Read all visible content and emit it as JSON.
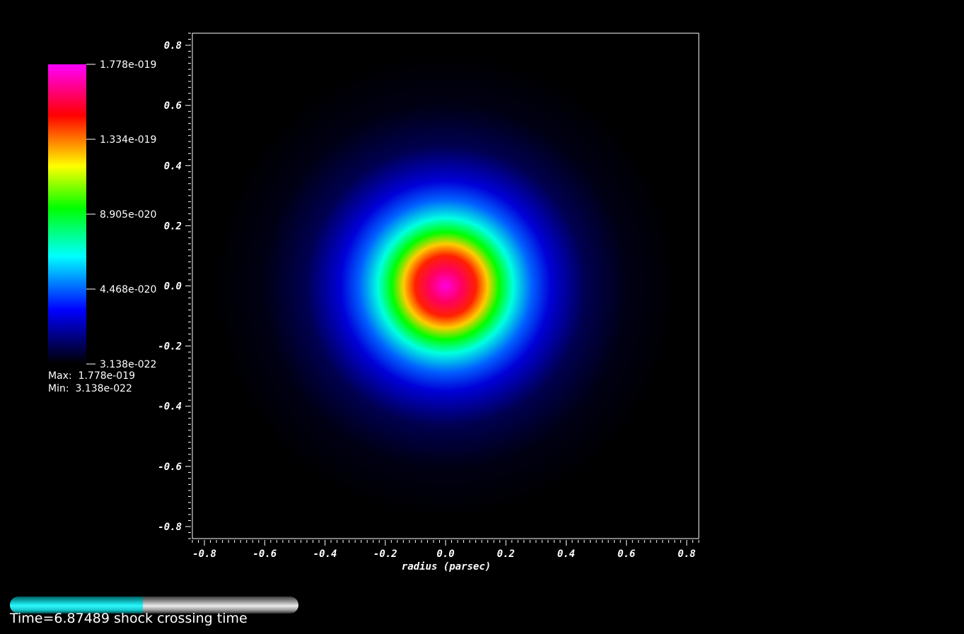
{
  "chart_data": {
    "type": "heatmap",
    "xlabel": "radius (parsec)",
    "ylabel": "",
    "xlim": [
      -0.84,
      0.84
    ],
    "ylim": [
      -0.84,
      0.84
    ],
    "x_ticks": [
      "-0.8",
      "-0.6",
      "-0.4",
      "-0.2",
      "0.0",
      "0.2",
      "0.4",
      "0.6",
      "0.8"
    ],
    "y_ticks": [
      "0.8",
      "0.6",
      "0.4",
      "0.2",
      "0.0",
      "-0.2",
      "-0.4",
      "-0.6",
      "-0.8"
    ],
    "field_center": [
      0.0,
      0.0
    ],
    "colormap": [
      "#000000",
      "#0000ff",
      "#00ffff",
      "#00ff00",
      "#ffff00",
      "#ff0000",
      "#ff00ff"
    ],
    "colorbar": {
      "min": 3.138e-22,
      "max": 1.778e-19,
      "tick_labels": [
        "1.778e-019",
        "1.334e-019",
        "8.905e-020",
        "4.468e-020",
        "3.138e-022"
      ]
    },
    "max_text": "Max:  1.778e-019",
    "min_text": "Min:  3.138e-022"
  },
  "time_slider": {
    "label": "Time=6.87489 shock crossing time",
    "progress": 0.46
  }
}
